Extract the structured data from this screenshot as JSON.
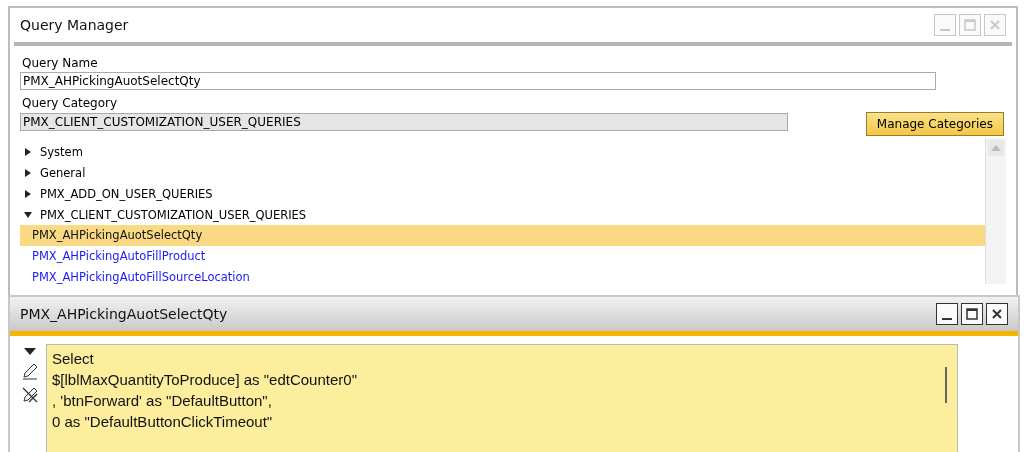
{
  "query_manager": {
    "title": "Query Manager",
    "active": false,
    "query_name": {
      "label": "Query Name",
      "value": "PMX_AHPickingAuotSelectQty"
    },
    "query_category": {
      "label": "Query Category",
      "value": "PMX_CLIENT_CUSTOMIZATION_USER_QUERIES"
    },
    "manage_button": "Manage Categories",
    "tree": [
      {
        "label": "System",
        "expanded": false
      },
      {
        "label": "General",
        "expanded": false
      },
      {
        "label": "PMX_ADD_ON_USER_QUERIES",
        "expanded": false
      },
      {
        "label": "PMX_CLIENT_CUSTOMIZATION_USER_QUERIES",
        "expanded": true,
        "children": [
          {
            "label": "PMX_AHPickingAuotSelectQty",
            "selected": true
          },
          {
            "label": "PMX_AHPickingAutoFillProduct",
            "selected": false
          },
          {
            "label": "PMX_AHPickingAutoFillSourceLocation",
            "selected": false
          }
        ]
      }
    ]
  },
  "query_window": {
    "title": "PMX_AHPickingAuotSelectQty",
    "active": true,
    "code_lines": [
      "Select",
      "$[lblMaxQuantityToProduce] as \"edtCounter0\"",
      ", 'btnForward' as \"DefaultButton\",",
      "0 as \"DefaultButtonClickTimeout\""
    ]
  }
}
